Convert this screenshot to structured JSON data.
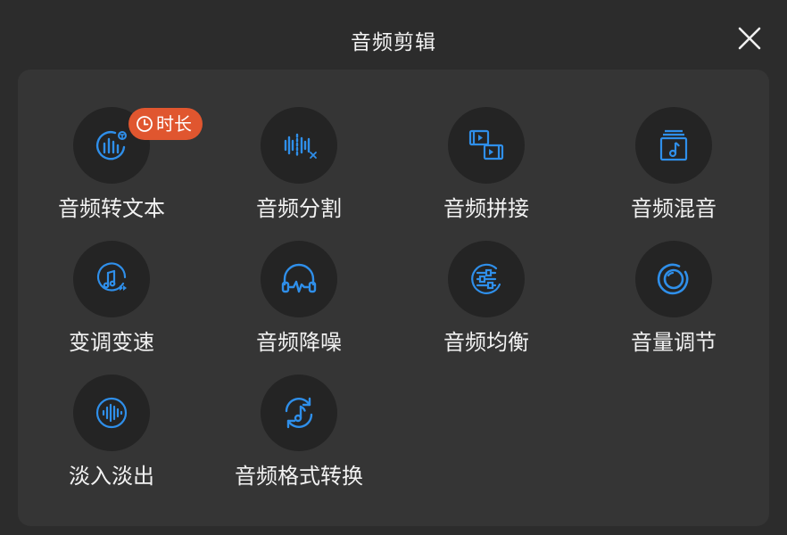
{
  "header": {
    "title": "音频剪辑",
    "close_icon": "close-icon"
  },
  "colors": {
    "icon_accent": "#2f8fea",
    "badge_bg": "#e0562f",
    "tile_bg": "#242424",
    "panel_bg": "#353535",
    "page_bg": "#2c2c2c"
  },
  "badge": {
    "icon": "clock-icon",
    "text": "时长"
  },
  "tools": [
    {
      "label": "音频转文本",
      "icon": "audio-to-text-icon"
    },
    {
      "label": "音频分割",
      "icon": "audio-split-icon"
    },
    {
      "label": "音频拼接",
      "icon": "audio-join-icon"
    },
    {
      "label": "音频混音",
      "icon": "audio-mix-icon"
    },
    {
      "label": "变调变速",
      "icon": "pitch-speed-icon"
    },
    {
      "label": "音频降噪",
      "icon": "noise-reduction-icon"
    },
    {
      "label": "音频均衡",
      "icon": "equalizer-icon"
    },
    {
      "label": "音量调节",
      "icon": "volume-adjust-icon"
    },
    {
      "label": "淡入淡出",
      "icon": "fade-in-out-icon"
    },
    {
      "label": "音频格式转换",
      "icon": "format-convert-icon"
    }
  ]
}
